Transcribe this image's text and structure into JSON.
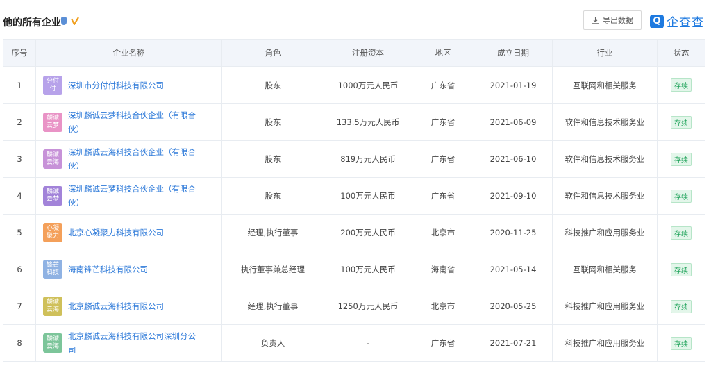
{
  "header": {
    "title": "他的所有企业",
    "export_label": "导出数据",
    "logo_mark": "Q",
    "logo_text": "企查查"
  },
  "table": {
    "columns": [
      "序号",
      "企业名称",
      "角色",
      "注册资本",
      "地区",
      "成立日期",
      "行业",
      "状态"
    ],
    "rows": [
      {
        "index": "1",
        "badge": "分付付",
        "badge_color": "#b7a2ea",
        "name": "深圳市分付付科技有限公司",
        "role": "股东",
        "capital": "1000万元人民币",
        "region": "广东省",
        "date": "2021-01-19",
        "industry": "互联网和相关服务",
        "status": "存续"
      },
      {
        "index": "2",
        "badge": "麟诚云梦",
        "badge_color": "#e993c6",
        "name": "深圳麟诚云梦科技合伙企业（有限合伙）",
        "role": "股东",
        "capital": "133.5万元人民币",
        "region": "广东省",
        "date": "2021-06-09",
        "industry": "软件和信息技术服务业",
        "status": "存续"
      },
      {
        "index": "3",
        "badge": "麟诚云海",
        "badge_color": "#c792d8",
        "name": "深圳麟诚云海科技合伙企业（有限合伙）",
        "role": "股东",
        "capital": "819万元人民币",
        "region": "广东省",
        "date": "2021-06-10",
        "industry": "软件和信息技术服务业",
        "status": "存续"
      },
      {
        "index": "4",
        "badge": "麟诚云梦",
        "badge_color": "#a283d9",
        "name": "深圳麟诚云梦科技合伙企业（有限合伙）",
        "role": "股东",
        "capital": "100万元人民币",
        "region": "广东省",
        "date": "2021-09-10",
        "industry": "软件和信息技术服务业",
        "status": "存续"
      },
      {
        "index": "5",
        "badge": "心凝聚力",
        "badge_color": "#f4a05a",
        "name": "北京心凝聚力科技有限公司",
        "role": "经理,执行董事",
        "capital": "200万元人民币",
        "region": "北京市",
        "date": "2020-11-25",
        "industry": "科技推广和应用服务业",
        "status": "存续"
      },
      {
        "index": "6",
        "badge": "锋芒科技",
        "badge_color": "#8fb2e3",
        "name": "海南锋芒科技有限公司",
        "role": "执行董事兼总经理",
        "capital": "100万元人民币",
        "region": "海南省",
        "date": "2021-05-14",
        "industry": "互联网和相关服务",
        "status": "存续"
      },
      {
        "index": "7",
        "badge": "麟诚云海",
        "badge_color": "#cfc05a",
        "name": "北京麟诚云海科技有限公司",
        "role": "经理,执行董事",
        "capital": "1250万元人民币",
        "region": "北京市",
        "date": "2020-05-25",
        "industry": "科技推广和应用服务业",
        "status": "存续"
      },
      {
        "index": "8",
        "badge": "麟诚云海",
        "badge_color": "#7cc59a",
        "name": "北京麟诚云海科技有限公司深圳分公司",
        "role": "负责人",
        "capital": "-",
        "region": "广东省",
        "date": "2021-07-21",
        "industry": "科技推广和应用服务业",
        "status": "存续"
      }
    ]
  },
  "icons": [
    "shield-icon",
    "v-verified-icon",
    "download-icon",
    "qcc-logo-icon"
  ],
  "colors": {
    "link": "#2e7ad9",
    "status_green": "#1fa35a",
    "header_bg": "#f2f5fa",
    "brand": "#1e7ae0"
  }
}
